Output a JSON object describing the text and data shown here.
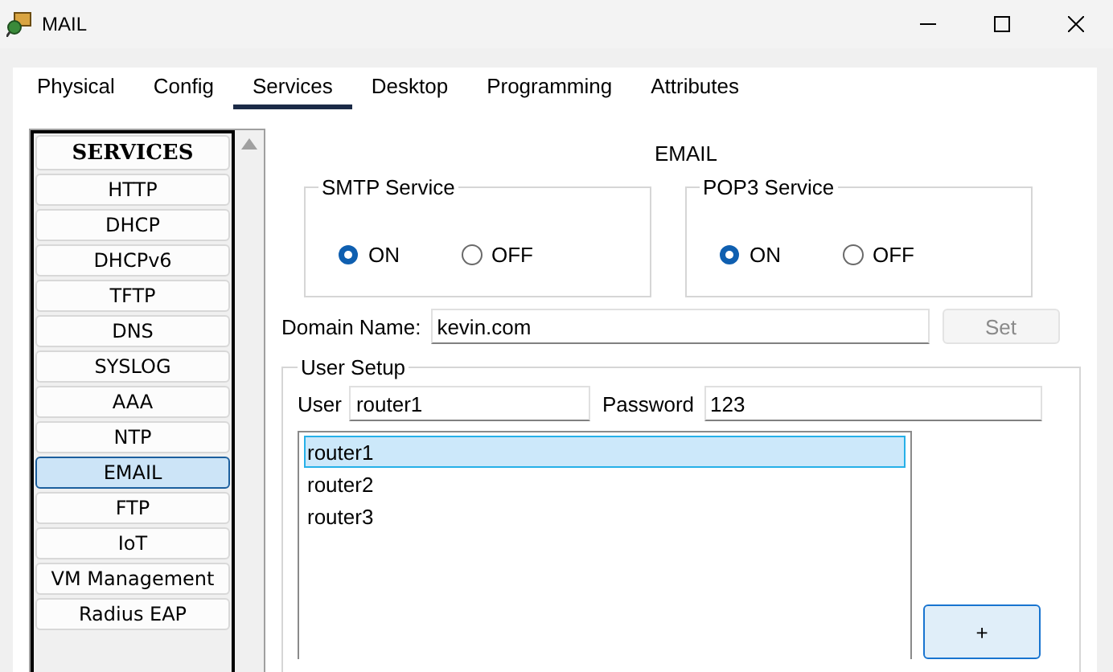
{
  "window": {
    "title": "MAIL"
  },
  "tabs": [
    {
      "label": "Physical",
      "selected": false
    },
    {
      "label": "Config",
      "selected": false
    },
    {
      "label": "Services",
      "selected": true
    },
    {
      "label": "Desktop",
      "selected": false
    },
    {
      "label": "Programming",
      "selected": false
    },
    {
      "label": "Attributes",
      "selected": false
    }
  ],
  "sidebar": {
    "header": "SERVICES",
    "items": [
      {
        "label": "HTTP",
        "selected": false
      },
      {
        "label": "DHCP",
        "selected": false
      },
      {
        "label": "DHCPv6",
        "selected": false
      },
      {
        "label": "TFTP",
        "selected": false
      },
      {
        "label": "DNS",
        "selected": false
      },
      {
        "label": "SYSLOG",
        "selected": false
      },
      {
        "label": "AAA",
        "selected": false
      },
      {
        "label": "NTP",
        "selected": false
      },
      {
        "label": "EMAIL",
        "selected": true
      },
      {
        "label": "FTP",
        "selected": false
      },
      {
        "label": "IoT",
        "selected": false
      },
      {
        "label": "VM Management",
        "selected": false
      },
      {
        "label": "Radius EAP",
        "selected": false
      }
    ]
  },
  "email": {
    "title": "EMAIL",
    "services": [
      {
        "title": "SMTP Service",
        "options": [
          {
            "label": "ON",
            "selected": true
          },
          {
            "label": "OFF",
            "selected": false
          }
        ]
      },
      {
        "title": "POP3 Service",
        "options": [
          {
            "label": "ON",
            "selected": true
          },
          {
            "label": "OFF",
            "selected": false
          }
        ]
      }
    ],
    "domain": {
      "label": "Domain Name:",
      "value": "kevin.com",
      "button": {
        "label": "Set",
        "disabled": true
      }
    },
    "user_setup": {
      "title": "User Setup",
      "user_label": "User",
      "user_value": "router1",
      "password_label": "Password",
      "password_value": "123",
      "users": [
        {
          "name": "router1",
          "selected": true
        },
        {
          "name": "router2",
          "selected": false
        },
        {
          "name": "router3",
          "selected": false
        }
      ],
      "add_button": "+"
    }
  }
}
